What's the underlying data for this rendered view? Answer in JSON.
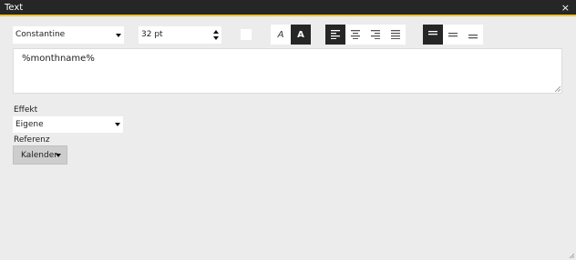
{
  "window": {
    "title": "Text",
    "close_glyph": "×"
  },
  "toolbar": {
    "font_family": "Constantine",
    "font_size": "32 pt",
    "text_color": "#ffffff",
    "style_buttons": [
      {
        "label": "A",
        "style": "italic",
        "active": false
      },
      {
        "label": "A",
        "style": "bold",
        "active": true
      }
    ],
    "horizontal_align": {
      "options": [
        "left",
        "center",
        "right",
        "justify"
      ],
      "selected": "left"
    },
    "vertical_align": {
      "options": [
        "top",
        "middle",
        "bottom"
      ],
      "selected": "top"
    }
  },
  "content": {
    "text": "%monthname%"
  },
  "effekt": {
    "label": "Effekt",
    "value": "Eigene"
  },
  "referenz": {
    "label": "Referenz",
    "button_label": "Kalender"
  },
  "colors": {
    "titlebar": "#262626",
    "accent": "#f2c230",
    "panel": "#ececec",
    "active": "#262626"
  }
}
